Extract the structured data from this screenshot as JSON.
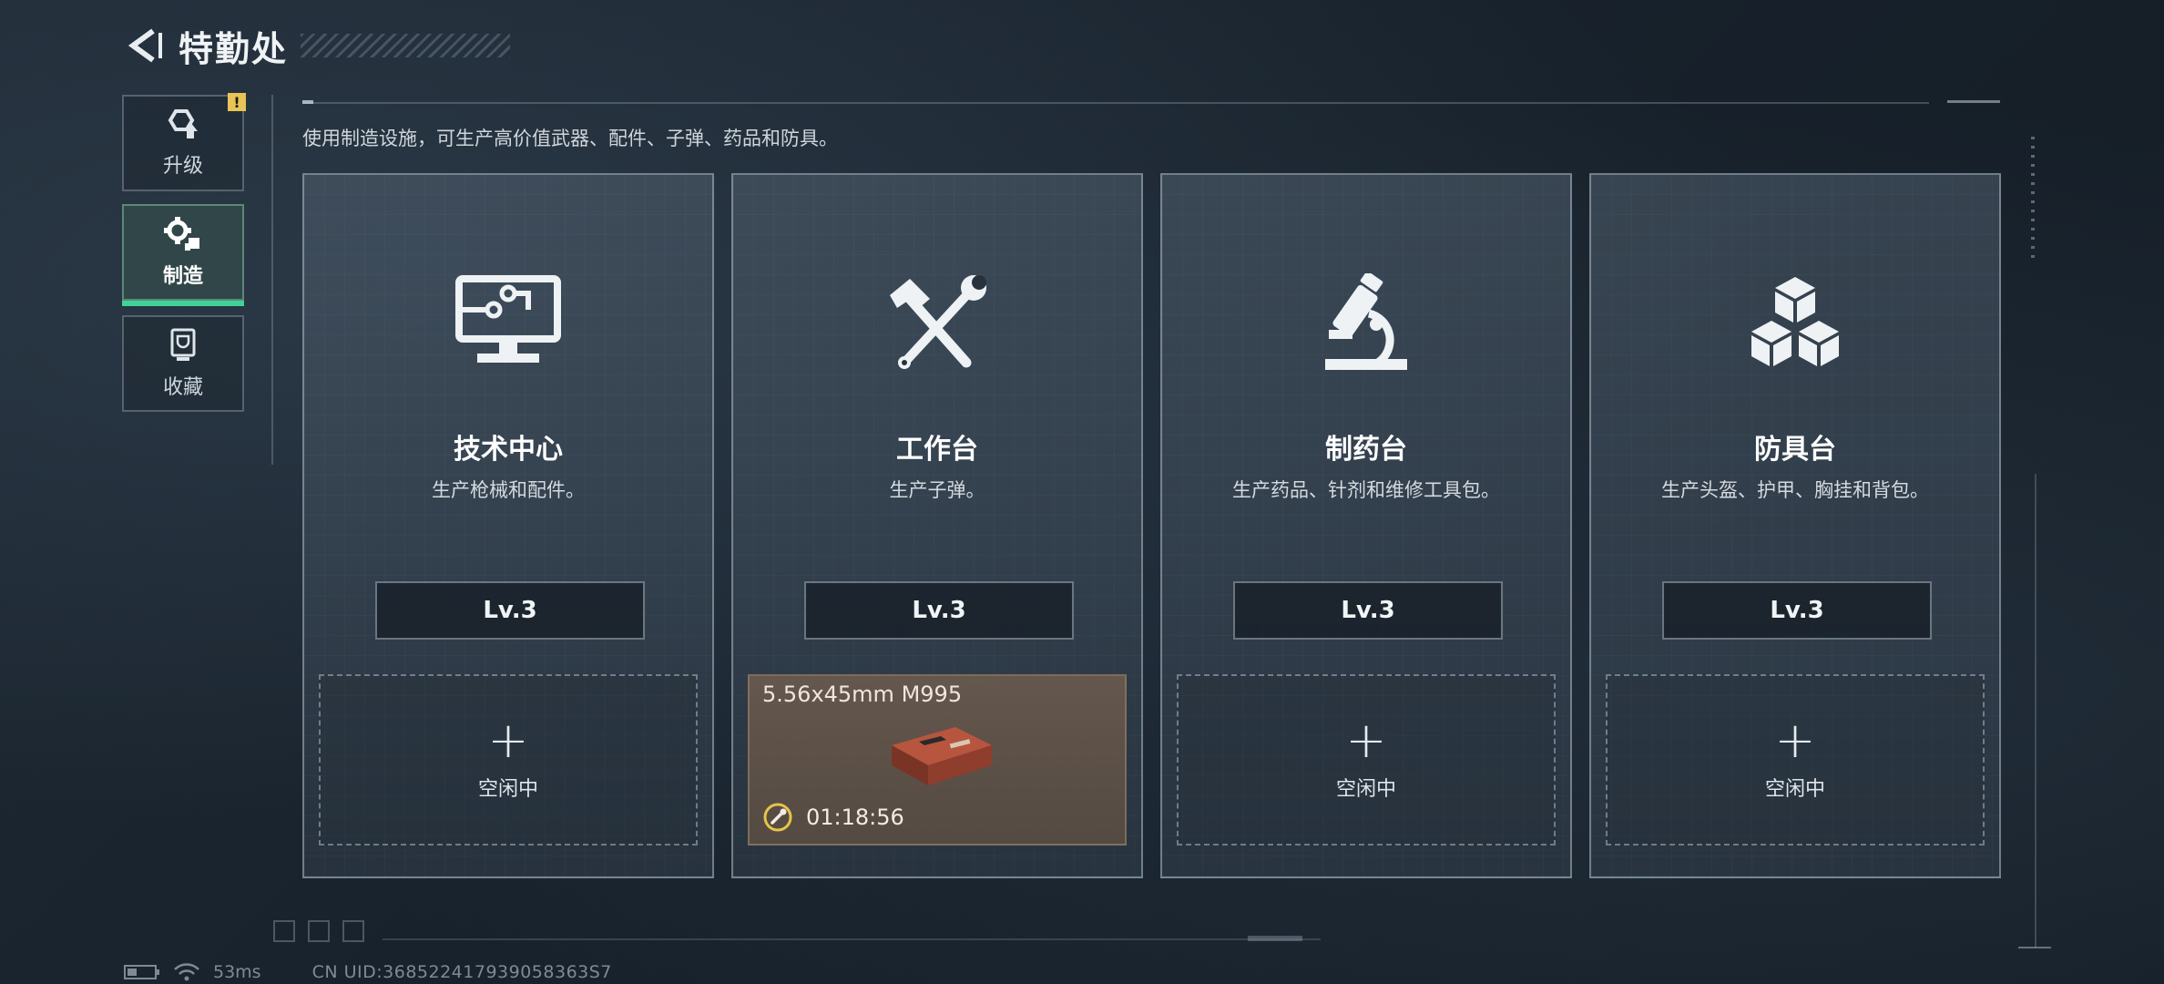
{
  "header": {
    "title": "特勤处"
  },
  "sidebar": {
    "items": [
      {
        "label": "升级",
        "icon": "upgrade-icon",
        "badge": "!"
      },
      {
        "label": "制造",
        "icon": "gear-craft-icon",
        "active": true
      },
      {
        "label": "收藏",
        "icon": "trophy-icon"
      }
    ]
  },
  "main": {
    "description": "使用制造设施，可生产高价值武器、配件、子弹、药品和防具。",
    "cards": [
      {
        "name": "技术中心",
        "desc": "生产枪械和配件。",
        "level": "Lv.3",
        "icon": "computer-circuit-icon",
        "slot": {
          "status": "空闲中"
        }
      },
      {
        "name": "工作台",
        "desc": "生产子弹。",
        "level": "Lv.3",
        "icon": "hammer-wrench-icon",
        "slot": {
          "item": "5.56x45mm M995",
          "timer": "01:18:56",
          "item_icon": "ammo-box-icon"
        }
      },
      {
        "name": "制药台",
        "desc": "生产药品、针剂和维修工具包。",
        "level": "Lv.3",
        "icon": "microscope-icon",
        "slot": {
          "status": "空闲中"
        }
      },
      {
        "name": "防具台",
        "desc": "生产头盔、护甲、胸挂和背包。",
        "level": "Lv.3",
        "icon": "cubes-icon",
        "slot": {
          "status": "空闲中"
        }
      }
    ]
  },
  "status_bar": {
    "ping": "53ms",
    "uid": "CN UID:368522417939058363S7"
  },
  "colors": {
    "accent": "#3fd39a",
    "warning": "#e8c457",
    "busy_slot": "#6e5c4e"
  }
}
